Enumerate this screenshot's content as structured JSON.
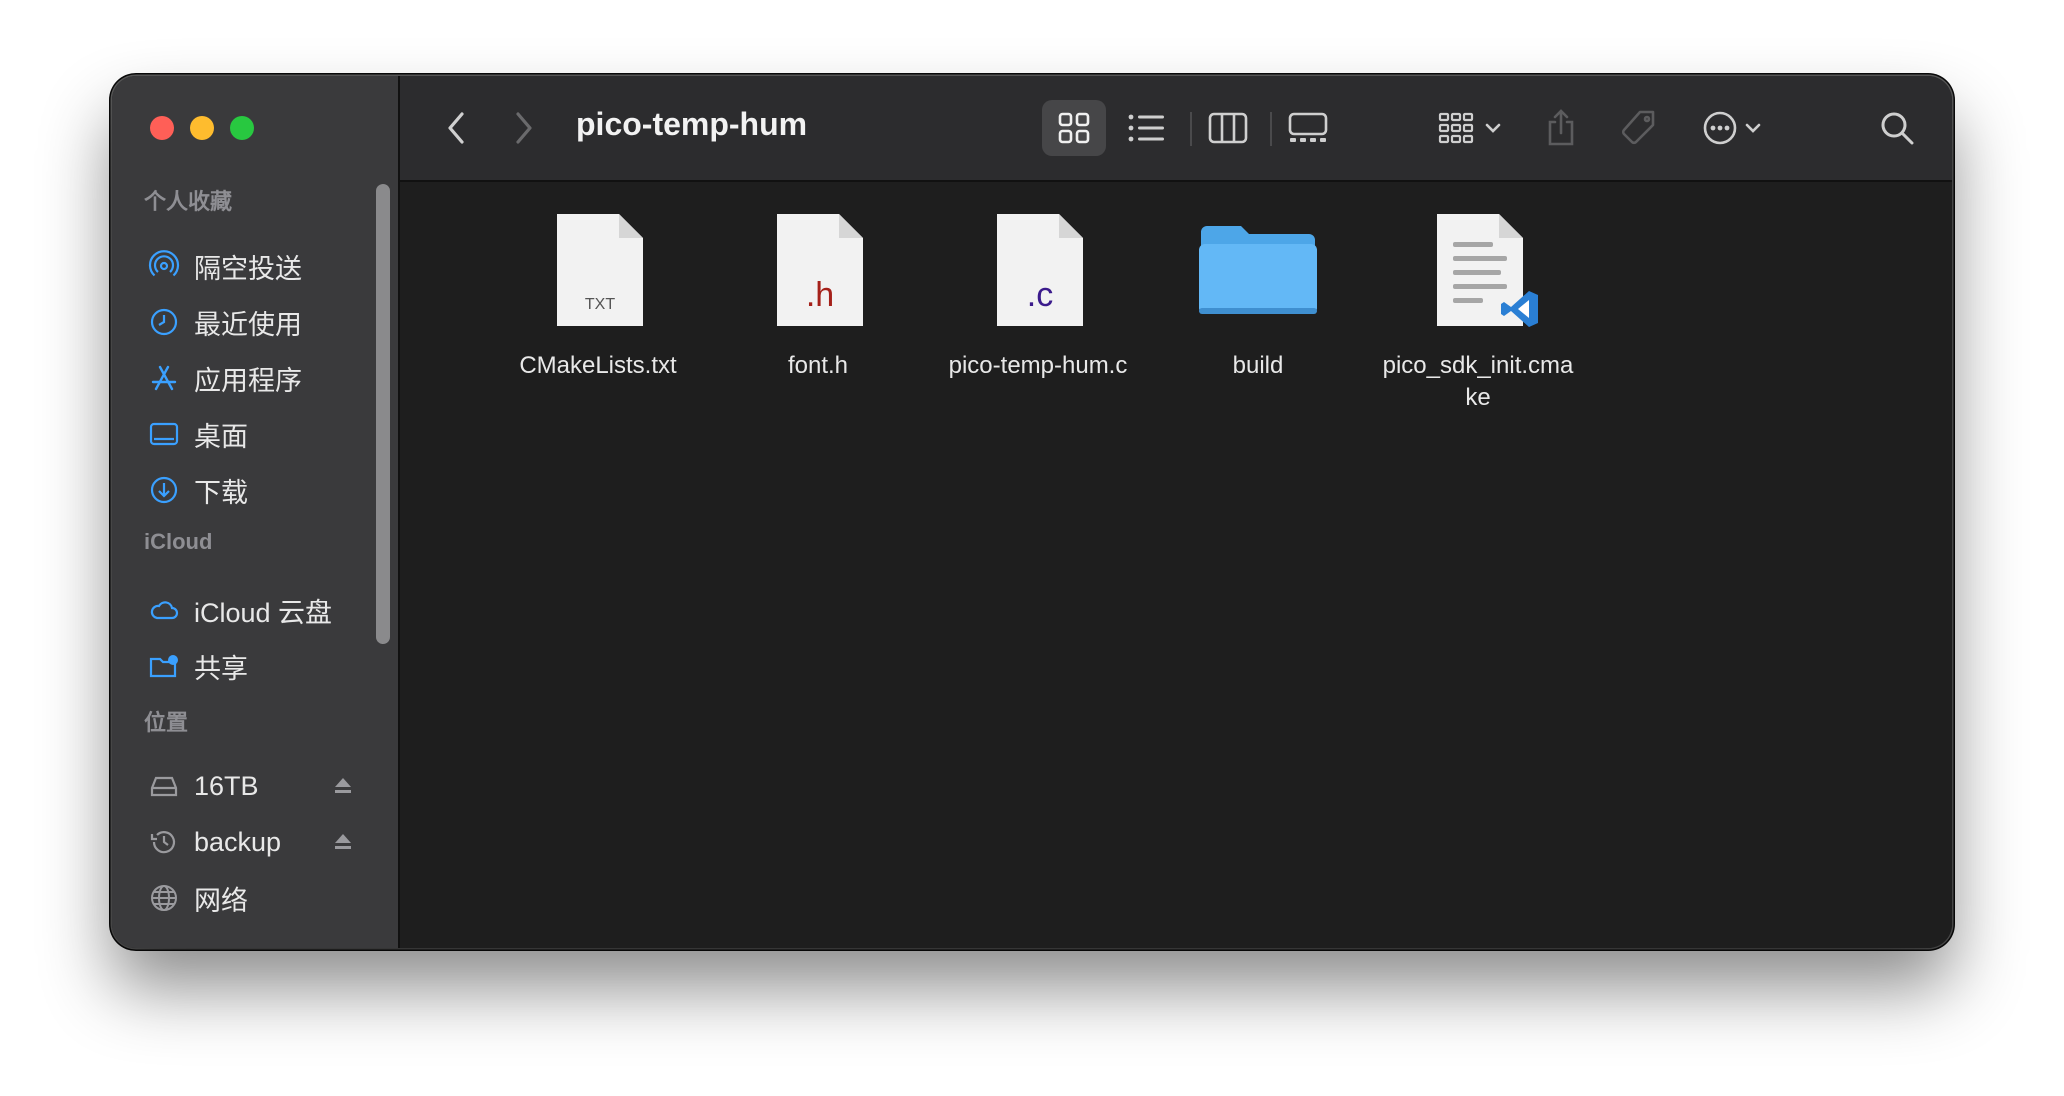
{
  "window": {
    "title": "pico-temp-hum"
  },
  "sidebar": {
    "favorites_header": "个人收藏",
    "favorites": [
      {
        "label": "隔空投送",
        "icon": "airdrop-icon"
      },
      {
        "label": "最近使用",
        "icon": "clock-icon"
      },
      {
        "label": "应用程序",
        "icon": "applications-icon"
      },
      {
        "label": "桌面",
        "icon": "desktop-icon"
      },
      {
        "label": "下载",
        "icon": "download-icon"
      }
    ],
    "icloud_header": "iCloud",
    "icloud": [
      {
        "label": "iCloud 云盘",
        "icon": "cloud-icon"
      },
      {
        "label": "共享",
        "icon": "shared-folder-icon"
      }
    ],
    "locations_header": "位置",
    "locations": [
      {
        "label": "16TB",
        "icon": "drive-icon",
        "ejectable": true
      },
      {
        "label": "backup",
        "icon": "time-machine-icon",
        "ejectable": true
      },
      {
        "label": "网络",
        "icon": "network-icon",
        "ejectable": false
      }
    ]
  },
  "toolbar": {
    "buttons": [
      "back-icon",
      "forward-icon",
      "icon-view-icon",
      "list-view-icon",
      "column-view-icon",
      "gallery-view-icon",
      "group-icon",
      "share-icon",
      "tag-icon",
      "more-icon",
      "search-icon"
    ],
    "active_view": "icon-view-icon"
  },
  "files": [
    {
      "name": "CMakeLists.txt",
      "kind": "txt",
      "badge": "TXT",
      "badge_color": "#555555"
    },
    {
      "name": "font.h",
      "kind": "source",
      "badge": ".h",
      "badge_color": "#a5211a"
    },
    {
      "name": "pico-temp-hum.c",
      "kind": "source",
      "badge": ".c",
      "badge_color": "#3b1b8c"
    },
    {
      "name": "build",
      "kind": "folder",
      "badge": "",
      "badge_color": "#5fb7f5"
    },
    {
      "name": "pico_sdk_init.cma\nke",
      "kind": "vscode",
      "badge": "",
      "badge_color": "#2a7fd4"
    }
  ]
}
